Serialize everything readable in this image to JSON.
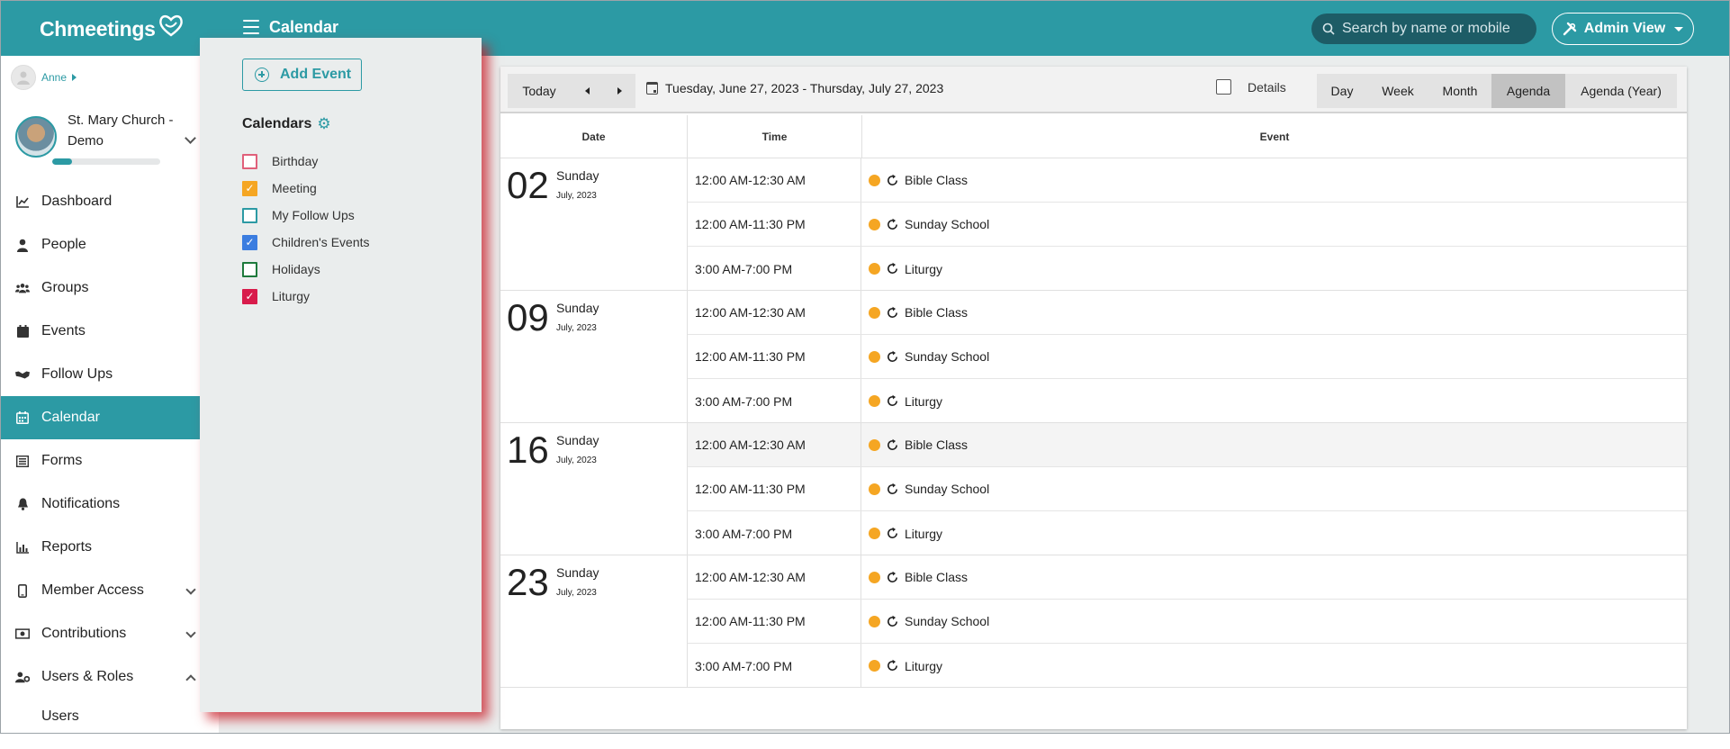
{
  "app": {
    "logo_text": "Chmeetings",
    "page_title": "Calendar",
    "search_placeholder": "Search by name or mobile",
    "admin_view_label": "Admin View"
  },
  "sidebar": {
    "user_name": "Anne",
    "church_name": "St. Mary Church - Demo",
    "profile_progress": 0.18,
    "items": [
      {
        "label": "Dashboard",
        "icon": "chart-line-icon"
      },
      {
        "label": "People",
        "icon": "person-icon"
      },
      {
        "label": "Groups",
        "icon": "users-icon"
      },
      {
        "label": "Events",
        "icon": "calendar-icon"
      },
      {
        "label": "Follow Ups",
        "icon": "handshake-icon"
      },
      {
        "label": "Calendar",
        "icon": "calendar-grid-icon",
        "active": true
      },
      {
        "label": "Forms",
        "icon": "list-icon"
      },
      {
        "label": "Notifications",
        "icon": "bell-icon"
      },
      {
        "label": "Reports",
        "icon": "bar-chart-icon"
      },
      {
        "label": "Member Access",
        "icon": "mobile-icon",
        "expandable": "collapsed"
      },
      {
        "label": "Contributions",
        "icon": "money-icon",
        "expandable": "collapsed"
      },
      {
        "label": "Users & Roles",
        "icon": "user-gear-icon",
        "expandable": "expanded"
      }
    ],
    "sub_items": [
      "Users"
    ]
  },
  "calendars_panel": {
    "add_event_label": "Add Event",
    "heading": "Calendars",
    "items": [
      {
        "label": "Birthday",
        "checked": false,
        "color": "#e0607a"
      },
      {
        "label": "Meeting",
        "checked": true,
        "color": "#f5a623"
      },
      {
        "label": "My Follow Ups",
        "checked": false,
        "color": "#2c9aa4"
      },
      {
        "label": "Children's Events",
        "checked": true,
        "color": "#3b7de0"
      },
      {
        "label": "Holidays",
        "checked": false,
        "color": "#1e7a3c"
      },
      {
        "label": "Liturgy",
        "checked": true,
        "color": "#d81b4b"
      }
    ]
  },
  "toolbar": {
    "today_label": "Today",
    "date_range": "Tuesday, June 27, 2023 - Thursday, July 27, 2023",
    "details_label": "Details",
    "details_checked": false,
    "views": [
      {
        "label": "Day",
        "active": false
      },
      {
        "label": "Week",
        "active": false
      },
      {
        "label": "Month",
        "active": false
      },
      {
        "label": "Agenda",
        "active": true
      },
      {
        "label": "Agenda (Year)",
        "active": false
      }
    ]
  },
  "agenda": {
    "headers": {
      "date": "Date",
      "time": "Time",
      "event": "Event"
    },
    "event_color": "#f5a623",
    "days": [
      {
        "day": "02",
        "weekday": "Sunday",
        "month_year": "July, 2023",
        "events": [
          {
            "time": "12:00 AM-12:30 AM",
            "title": "Bible Class"
          },
          {
            "time": "12:00 AM-11:30 PM",
            "title": "Sunday School"
          },
          {
            "time": "3:00 AM-7:00 PM",
            "title": "Liturgy"
          }
        ]
      },
      {
        "day": "09",
        "weekday": "Sunday",
        "month_year": "July, 2023",
        "events": [
          {
            "time": "12:00 AM-12:30 AM",
            "title": "Bible Class"
          },
          {
            "time": "12:00 AM-11:30 PM",
            "title": "Sunday School"
          },
          {
            "time": "3:00 AM-7:00 PM",
            "title": "Liturgy"
          }
        ]
      },
      {
        "day": "16",
        "weekday": "Sunday",
        "month_year": "July, 2023",
        "events": [
          {
            "time": "12:00 AM-12:30 AM",
            "title": "Bible Class",
            "highlighted": true
          },
          {
            "time": "12:00 AM-11:30 PM",
            "title": "Sunday School"
          },
          {
            "time": "3:00 AM-7:00 PM",
            "title": "Liturgy"
          }
        ]
      },
      {
        "day": "23",
        "weekday": "Sunday",
        "month_year": "July, 2023",
        "events": [
          {
            "time": "12:00 AM-12:30 AM",
            "title": "Bible Class"
          },
          {
            "time": "12:00 AM-11:30 PM",
            "title": "Sunday School"
          },
          {
            "time": "3:00 AM-7:00 PM",
            "title": "Liturgy"
          }
        ]
      }
    ]
  }
}
